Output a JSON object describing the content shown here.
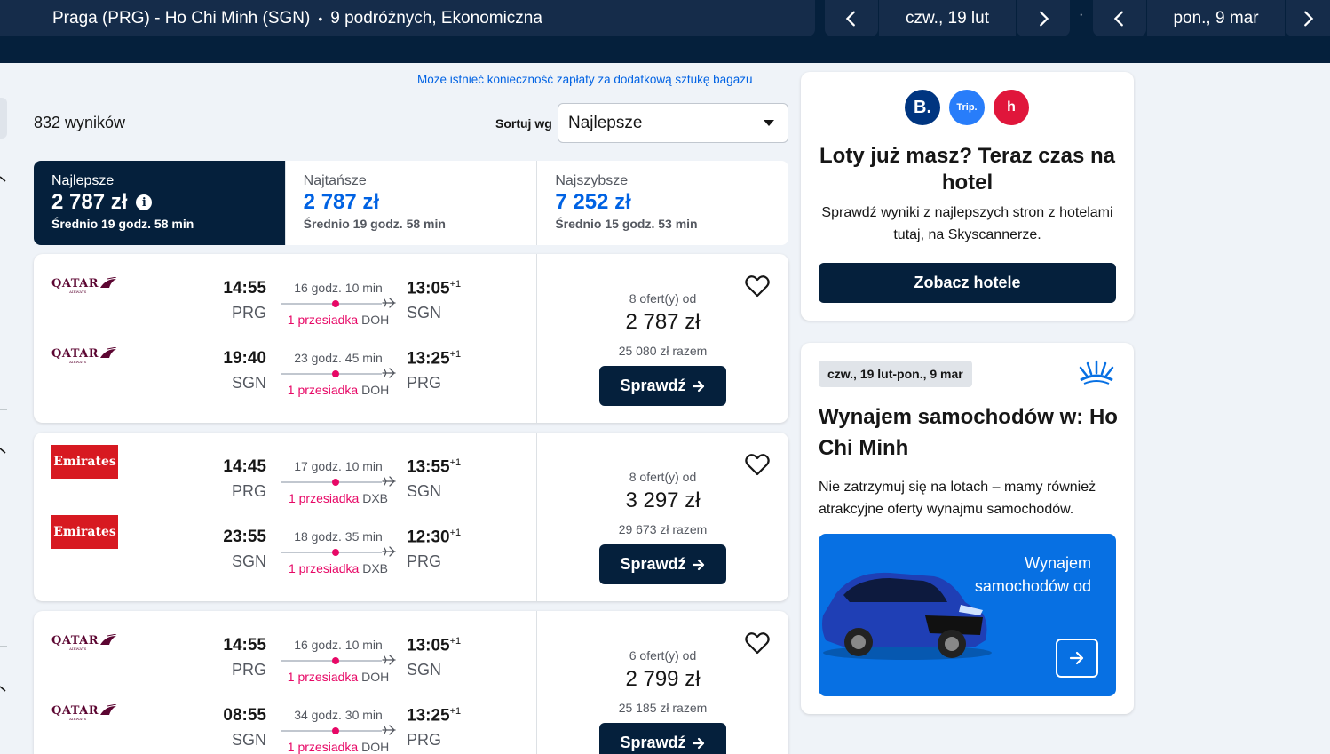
{
  "header": {
    "route": "Praga (PRG) - Ho Chi Minh (SGN)",
    "separator": "•",
    "travellers": "9 podróżnych, Ekonomiczna",
    "depart_date": "czw., 19 lut",
    "return_date": "pon., 9 mar",
    "date_separator": "·"
  },
  "bag_note": "Może istnieć konieczność zapłaty za dodatkową sztukę bagażu",
  "results_count": "832 wyników",
  "sort": {
    "label": "Sortuj wg",
    "value": "Najlepsze"
  },
  "tabs": [
    {
      "name": "Najlepsze",
      "price": "2 787 zł",
      "duration": "Średnio 19 godz. 58 min",
      "active": true
    },
    {
      "name": "Najtańsze",
      "price": "2 787 zł",
      "duration": "Średnio 19 godz. 58 min",
      "active": false
    },
    {
      "name": "Najszybsze",
      "price": "7 252 zł",
      "duration": "Średnio 15 godz. 53 min",
      "active": false
    }
  ],
  "results": [
    {
      "airline": "qatar",
      "legs": [
        {
          "dep_time": "14:55",
          "dep_code": "PRG",
          "duration": "16 godz. 10 min",
          "stops": "1 przesiadka",
          "via": "DOH",
          "arr_time": "13:05",
          "arr_offset": "+1",
          "arr_code": "SGN"
        },
        {
          "dep_time": "19:40",
          "dep_code": "SGN",
          "duration": "23 godz. 45 min",
          "stops": "1 przesiadka",
          "via": "DOH",
          "arr_time": "13:25",
          "arr_offset": "+1",
          "arr_code": "PRG"
        }
      ],
      "offers": "8 ofert(y) od",
      "price": "2 787 zł",
      "total": "25 080 zł razem",
      "button": "Sprawdź"
    },
    {
      "airline": "emirates",
      "legs": [
        {
          "dep_time": "14:45",
          "dep_code": "PRG",
          "duration": "17 godz. 10 min",
          "stops": "1 przesiadka",
          "via": "DXB",
          "arr_time": "13:55",
          "arr_offset": "+1",
          "arr_code": "SGN"
        },
        {
          "dep_time": "23:55",
          "dep_code": "SGN",
          "duration": "18 godz. 35 min",
          "stops": "1 przesiadka",
          "via": "DXB",
          "arr_time": "12:30",
          "arr_offset": "+1",
          "arr_code": "PRG"
        }
      ],
      "offers": "8 ofert(y) od",
      "price": "3 297 zł",
      "total": "29 673 zł razem",
      "button": "Sprawdź"
    },
    {
      "airline": "qatar",
      "legs": [
        {
          "dep_time": "14:55",
          "dep_code": "PRG",
          "duration": "16 godz. 10 min",
          "stops": "1 przesiadka",
          "via": "DOH",
          "arr_time": "13:05",
          "arr_offset": "+1",
          "arr_code": "SGN"
        },
        {
          "dep_time": "08:55",
          "dep_code": "SGN",
          "duration": "34 godz. 30 min",
          "stops": "1 przesiadka",
          "via": "DOH",
          "arr_time": "13:25",
          "arr_offset": "+1",
          "arr_code": "PRG"
        }
      ],
      "offers": "6 ofert(y) od",
      "price": "2 799 zł",
      "total": "25 185 zł razem",
      "button": "Sprawdź"
    }
  ],
  "logos": {
    "qatar_text": "QATAR",
    "qatar_sub": "AIRWAYS",
    "emirates_text": "Emirates"
  },
  "hotel_promo": {
    "partners": [
      "B.",
      "Trip.",
      "h"
    ],
    "title": "Loty już masz? Teraz czas na hotel",
    "desc": "Sprawdź wyniki z najlepszych stron z hotelami tutaj, na Skyscannerze.",
    "button": "Zobacz hotele"
  },
  "car_promo": {
    "dates": "czw., 19 lut-pon., 9 mar",
    "title": "Wynajem samochodów w: Ho Chi Minh",
    "desc": "Nie zatrzymuj się na lotach – mamy również atrakcyjne oferty wynajmu samochodów.",
    "banner_text": "Wynajem samochodów od"
  },
  "colors": {
    "navy": "#05203c",
    "blue": "#0062e3",
    "pink": "#e70866",
    "banner_blue": "#0770e3"
  }
}
